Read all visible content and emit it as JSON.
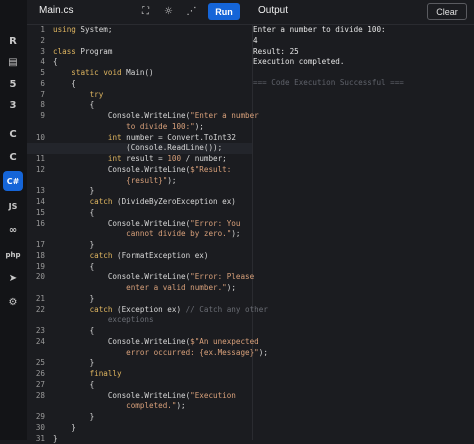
{
  "sidebar": {
    "items": [
      {
        "name": "r-icon",
        "glyph": "R"
      },
      {
        "name": "database-icon",
        "glyph": "▤"
      },
      {
        "name": "html5-icon",
        "glyph": "5"
      },
      {
        "name": "css3-icon",
        "glyph": "3"
      },
      {
        "name": "c-icon",
        "glyph": "C"
      },
      {
        "name": "cpp-icon",
        "glyph": "C"
      },
      {
        "name": "csharp-icon",
        "glyph": "C#"
      },
      {
        "name": "js-icon",
        "glyph": "JS"
      },
      {
        "name": "go-icon",
        "glyph": "∞"
      },
      {
        "name": "php-icon",
        "glyph": "php"
      },
      {
        "name": "swift-icon",
        "glyph": "➤"
      },
      {
        "name": "rust-icon",
        "glyph": "⚙"
      }
    ],
    "active_index": 6
  },
  "header": {
    "file_tab": "Main.cs",
    "fullscreen_icon": "⛶",
    "theme_icon": "☼",
    "share_icon": "⋰",
    "run_label": "Run",
    "output_title": "Output",
    "clear_label": "Clear"
  },
  "editor": {
    "lines": [
      {
        "n": "1",
        "t": "using System;"
      },
      {
        "n": "2",
        "t": ""
      },
      {
        "n": "3",
        "t": "class Program"
      },
      {
        "n": "4",
        "t": "{"
      },
      {
        "n": "5",
        "t": "    static void Main()"
      },
      {
        "n": "6",
        "t": "    {"
      },
      {
        "n": "7",
        "t": "        try"
      },
      {
        "n": "8",
        "t": "        {"
      },
      {
        "n": "9",
        "t": "            Console.WriteLine(\"Enter a number"
      },
      {
        "n": "",
        "t": "                to divide 100:\");"
      },
      {
        "n": "10",
        "t": "            int number = Convert.ToInt32"
      },
      {
        "n": "",
        "t": "                (Console.ReadLine());"
      },
      {
        "n": "11",
        "t": "            int result = 100 / number;"
      },
      {
        "n": "12",
        "t": "            Console.WriteLine($\"Result:"
      },
      {
        "n": "",
        "t": "                {result}\");"
      },
      {
        "n": "13",
        "t": "        }"
      },
      {
        "n": "14",
        "t": "        catch (DivideByZeroException ex)"
      },
      {
        "n": "15",
        "t": "        {"
      },
      {
        "n": "16",
        "t": "            Console.WriteLine(\"Error: You"
      },
      {
        "n": "",
        "t": "                cannot divide by zero.\");"
      },
      {
        "n": "17",
        "t": "        }"
      },
      {
        "n": "18",
        "t": "        catch (FormatException ex)"
      },
      {
        "n": "19",
        "t": "        {"
      },
      {
        "n": "20",
        "t": "            Console.WriteLine(\"Error: Please"
      },
      {
        "n": "",
        "t": "                enter a valid number.\");"
      },
      {
        "n": "21",
        "t": "        }"
      },
      {
        "n": "22",
        "t": "        catch (Exception ex) // Catch any other"
      },
      {
        "n": "",
        "t": "            exceptions"
      },
      {
        "n": "23",
        "t": "        {"
      },
      {
        "n": "24",
        "t": "            Console.WriteLine($\"An unexpected"
      },
      {
        "n": "",
        "t": "                error occurred: {ex.Message}\");"
      },
      {
        "n": "25",
        "t": "        }"
      },
      {
        "n": "26",
        "t": "        finally"
      },
      {
        "n": "27",
        "t": "        {"
      },
      {
        "n": "28",
        "t": "            Console.WriteLine(\"Execution"
      },
      {
        "n": "",
        "t": "                completed.\");"
      },
      {
        "n": "29",
        "t": "        }"
      },
      {
        "n": "30",
        "t": "    }"
      },
      {
        "n": "31",
        "t": "}"
      }
    ],
    "highlight_rows": [
      11
    ]
  },
  "output": {
    "lines": [
      "Enter a number to divide 100:",
      "4",
      "Result: 25",
      "Execution completed."
    ],
    "status": "=== Code Execution Successful ==="
  },
  "colors": {
    "accent": "#1565d8",
    "background": "#1b1c20",
    "sidebar": "#131417"
  }
}
